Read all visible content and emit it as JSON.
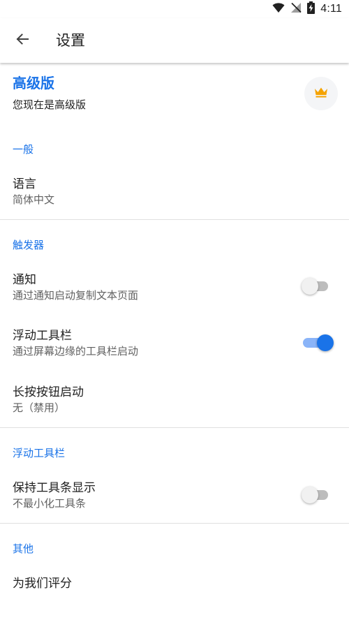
{
  "status_bar": {
    "time": "4:11",
    "icons": [
      "wifi-icon",
      "no-signal-icon",
      "battery-charging-icon"
    ]
  },
  "app_bar": {
    "title": "设置",
    "back_icon": "arrow-back-icon"
  },
  "premium": {
    "title": "高级版",
    "subtitle": "您现在是高级版",
    "icon": "crown-icon",
    "icon_color": "#f5a300"
  },
  "sections": {
    "general": {
      "header": "一般",
      "language": {
        "title": "语言",
        "value": "简体中文"
      }
    },
    "trigger": {
      "header": "触发器",
      "notification": {
        "title": "通知",
        "subtitle": "通过通知启动复制文本页面",
        "enabled": false
      },
      "floating_toolbar": {
        "title": "浮动工具栏",
        "subtitle": "通过屏幕边缘的工具栏启动",
        "enabled": true
      },
      "long_press": {
        "title": "长按按钮启动",
        "value": "无（禁用）"
      }
    },
    "floating_toolbar": {
      "header": "浮动工具栏",
      "keep_visible": {
        "title": "保持工具条显示",
        "subtitle": "不最小化工具条",
        "enabled": false
      }
    },
    "other": {
      "header": "其他",
      "rate": {
        "title": "为我们评分"
      }
    }
  },
  "colors": {
    "accent": "#1a73e8",
    "switch_on_track": "#8ab4f8",
    "switch_off_track": "#bdbdbd",
    "divider": "#e0e0e0"
  }
}
